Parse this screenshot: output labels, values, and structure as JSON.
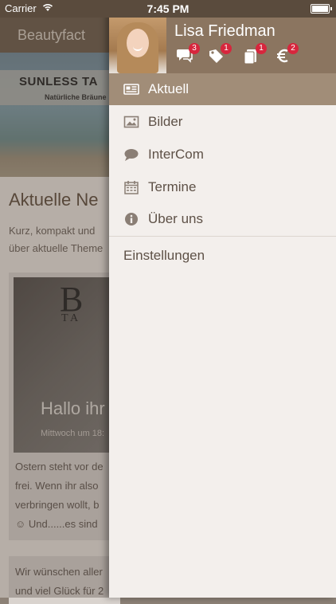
{
  "status_bar": {
    "carrier": "Carrier",
    "time": "7:45 PM"
  },
  "background": {
    "nav_title": "Beautyfact",
    "banner_title": "SUNLESS TA",
    "banner_subtitle": "Natürliche Bräune",
    "news_heading": "Aktuelle Ne",
    "news_intro_1": "Kurz, kompakt und",
    "news_intro_2": "über aktuelle Theme",
    "card": {
      "monogram_big": "B",
      "monogram_small": "T A",
      "title": "Hallo ihr",
      "date": "Mittwoch um 18:",
      "lines": [
        "Ostern steht vor de",
        "frei. Wenn ihr also",
        "verbringen wollt, b",
        "☺ Und......es sind"
      ]
    },
    "card2": {
      "lines": [
        "Wir wünschen aller",
        "und viel Glück für 2"
      ]
    }
  },
  "drawer": {
    "user_name": "Lisa Friedman",
    "header_icons": [
      {
        "name": "chat-icon",
        "badge": "3"
      },
      {
        "name": "tag-icon",
        "badge": "1"
      },
      {
        "name": "cards-icon",
        "badge": "1"
      },
      {
        "name": "euro-icon",
        "badge": "2"
      }
    ],
    "menu": [
      {
        "id": "aktuell",
        "label": "Aktuell",
        "icon": "newspaper-icon",
        "active": true
      },
      {
        "id": "bilder",
        "label": "Bilder",
        "icon": "image-icon",
        "active": false
      },
      {
        "id": "intercom",
        "label": "InterCom",
        "icon": "speech-bubble-icon",
        "active": false
      },
      {
        "id": "termine",
        "label": "Termine",
        "icon": "calendar-icon",
        "active": false
      },
      {
        "id": "ueber-uns",
        "label": "Über uns",
        "icon": "info-icon",
        "active": false
      }
    ],
    "settings_label": "Einstellungen"
  },
  "colors": {
    "accent": "#8b7560",
    "active_item": "#a18d78",
    "badge": "#d7263d",
    "drawer_bg": "#f3efec"
  }
}
